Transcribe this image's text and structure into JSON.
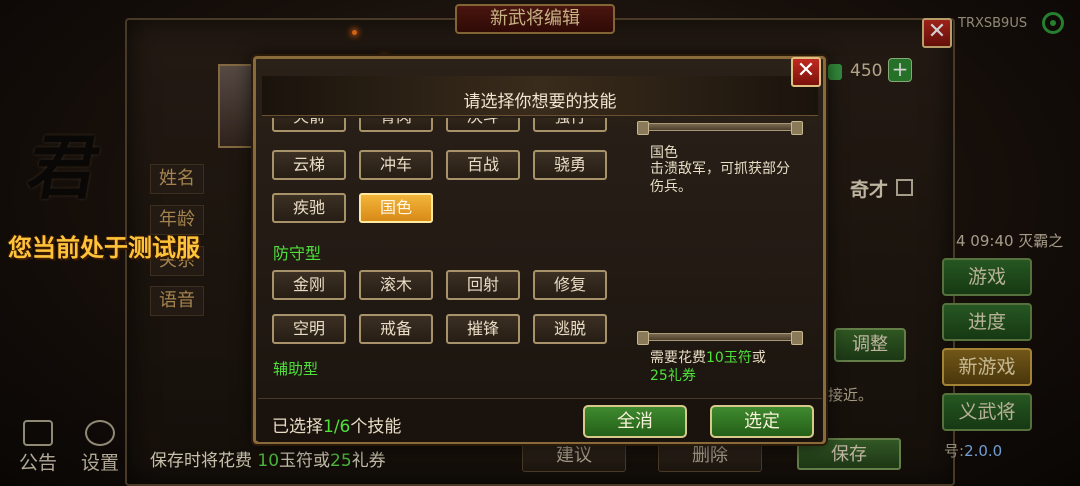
{
  "background": {
    "title": "新武将编辑",
    "close_glyph": "✕",
    "user_id": "TRXSB9US",
    "calligraphy": "君",
    "side_labels": [
      "姓名",
      "年龄",
      "关系",
      "语音"
    ],
    "test_server_notice": "您当前处于测试服",
    "currency_value": "450",
    "plus_glyph": "+",
    "qicai_label": "奇才",
    "side_text": "4 09:40 灭霸之",
    "right_buttons": [
      {
        "label": "游戏",
        "style": "green"
      },
      {
        "label": "进度",
        "style": "green"
      },
      {
        "label": "新游戏",
        "style": "gold"
      },
      {
        "label": "义武将",
        "style": "green"
      }
    ],
    "adjust_label": "调整",
    "approach_text": "接近。",
    "version_label": "号:",
    "version_value": "2.0.0",
    "bottom_icons": [
      {
        "icon": "announcement-icon",
        "label": "公告"
      },
      {
        "icon": "settings-gear-icon",
        "label": "设置"
      }
    ],
    "save_cost": {
      "prefix": "保存时将花费 ",
      "jade": "10",
      "middle": "玉符或",
      "coupon": "25",
      "suffix": "礼券"
    },
    "bottom_buttons": [
      "建议",
      "删除",
      "保存"
    ]
  },
  "dialog": {
    "title": "请选择你想要的技能",
    "close_glyph": "✕",
    "cut_row": [
      "火箭",
      "骨肉",
      "决斗",
      "强行"
    ],
    "attack_rows": [
      [
        {
          "label": "云梯",
          "selected": false
        },
        {
          "label": "冲车",
          "selected": false
        },
        {
          "label": "百战",
          "selected": false
        },
        {
          "label": "骁勇",
          "selected": false
        }
      ],
      [
        {
          "label": "疾驰",
          "selected": false
        },
        {
          "label": "国色",
          "selected": true
        }
      ]
    ],
    "categories": {
      "defense": "防守型",
      "support": "辅助型"
    },
    "defense_rows": [
      [
        {
          "label": "金刚",
          "selected": false
        },
        {
          "label": "滚木",
          "selected": false
        },
        {
          "label": "回射",
          "selected": false
        },
        {
          "label": "修复",
          "selected": false
        }
      ],
      [
        {
          "label": "空明",
          "selected": false
        },
        {
          "label": "戒备",
          "selected": false
        },
        {
          "label": "摧锋",
          "selected": false
        },
        {
          "label": "逃脱",
          "selected": false
        }
      ]
    ],
    "description": {
      "name": "国色",
      "text": "击溃敌军，可抓获部分伤兵。"
    },
    "cost": {
      "prefix": "需要花费",
      "jade": "10玉符",
      "middle": "或",
      "coupon": "25礼券"
    },
    "selected": {
      "prefix": "已选择",
      "count": "1/6",
      "suffix": "个技能"
    },
    "buttons": {
      "clear": "全消",
      "confirm": "选定"
    }
  }
}
